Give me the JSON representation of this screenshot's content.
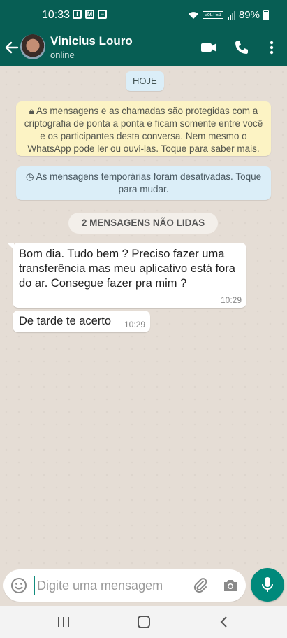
{
  "status_bar": {
    "time": "10:33",
    "notification_icons": [
      "facebook-icon",
      "gmail-icon",
      "news-icon"
    ],
    "lte_label": "VoLTE1",
    "battery": "89%"
  },
  "header": {
    "contact_name": "Vinicius Louro",
    "contact_status": "online",
    "accent_color": "#075e54"
  },
  "chat": {
    "date_chip": "HOJE",
    "encryption_notice": "As mensagens e as chamadas são protegidas com a criptografia de ponta a ponta e ficam somente entre você e os participantes desta conversa. Nem mesmo o WhatsApp pode ler ou ouvi-las. Toque para saber mais.",
    "temporary_notice": "As mensagens temporárias foram desativadas. Toque para mudar.",
    "unread_banner": "2 MENSAGENS NÃO LIDAS",
    "messages": [
      {
        "text": "Bom dia. Tudo bem ? Preciso fazer uma transferência mas meu aplicativo está fora do ar. Consegue fazer pra mim ?",
        "time": "10:29"
      },
      {
        "text": "De tarde te acerto",
        "time": "10:29"
      }
    ]
  },
  "composer": {
    "placeholder": "Digite uma mensagem",
    "send_button_color": "#00897b"
  }
}
